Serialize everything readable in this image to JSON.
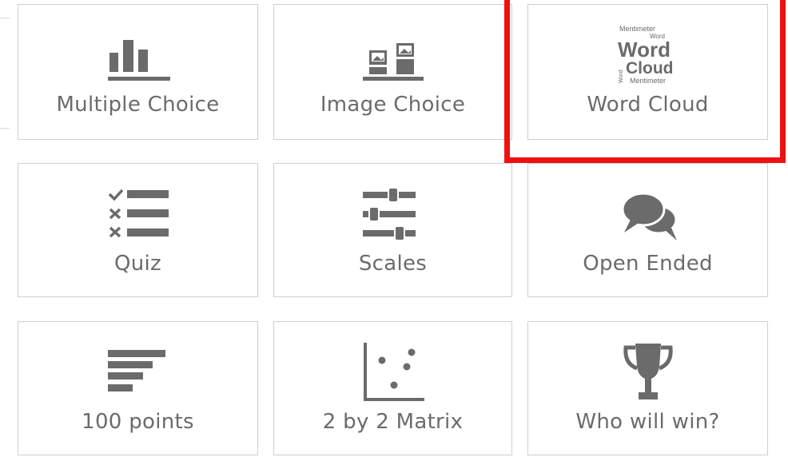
{
  "question_types": [
    {
      "label": "Multiple Choice",
      "icon": "bar-chart-icon"
    },
    {
      "label": "Image Choice",
      "icon": "image-choice-icon"
    },
    {
      "label": "Word Cloud",
      "icon": "word-cloud-icon"
    },
    {
      "label": "Quiz",
      "icon": "quiz-checklist-icon"
    },
    {
      "label": "Scales",
      "icon": "sliders-icon"
    },
    {
      "label": "Open Ended",
      "icon": "speech-bubbles-icon"
    },
    {
      "label": "100 points",
      "icon": "horizontal-bars-icon"
    },
    {
      "label": "2 by 2 Matrix",
      "icon": "scatter-matrix-icon"
    },
    {
      "label": "Who will win?",
      "icon": "trophy-icon"
    }
  ],
  "word_cloud_icon_text": {
    "big_word": "Word",
    "big_cloud": "Cloud",
    "small_brand": "Mentimeter",
    "small_word": "Word",
    "side_word": "Word"
  },
  "colors": {
    "icon": "#6b6b6b",
    "label": "#6b6b6b",
    "border": "#cfcfcf",
    "highlight": "#ee1111"
  },
  "highlighted": "Word Cloud"
}
